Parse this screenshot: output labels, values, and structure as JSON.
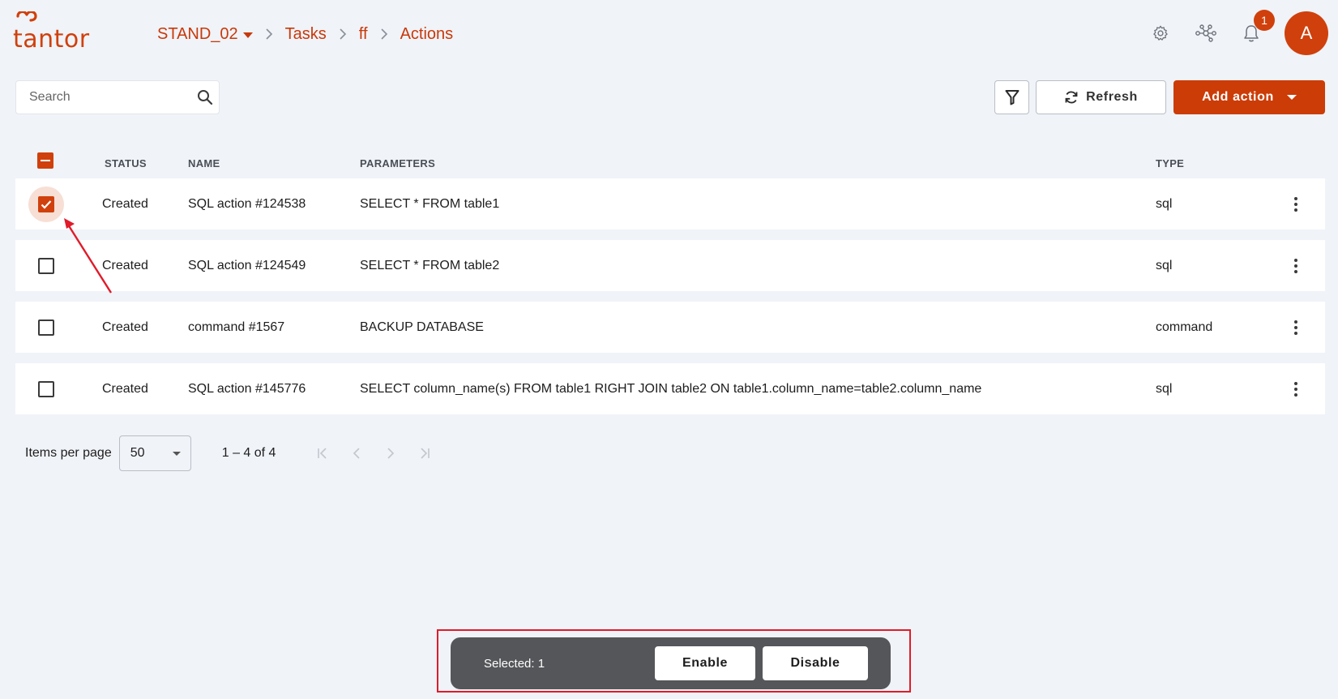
{
  "header": {
    "logo_text": "tantor",
    "breadcrumb": [
      {
        "label": "STAND_02",
        "has_dropdown": true
      },
      {
        "label": "Tasks"
      },
      {
        "label": "ff"
      },
      {
        "label": "Actions"
      }
    ],
    "notification_count": "1",
    "avatar_letter": "A",
    "icons": [
      "gear-icon",
      "network-icon",
      "bell-icon"
    ]
  },
  "toolbar": {
    "search_placeholder": "Search",
    "refresh_label": "Refresh",
    "add_action_label": "Add action"
  },
  "table": {
    "columns": [
      "STATUS",
      "NAME",
      "PARAMETERS",
      "TYPE"
    ],
    "rows": [
      {
        "checked": true,
        "status": "Created",
        "name": "SQL action #124538",
        "parameters": "SELECT * FROM table1",
        "type": "sql"
      },
      {
        "checked": false,
        "status": "Created",
        "name": "SQL action #124549",
        "parameters": "SELECT * FROM table2",
        "type": "sql"
      },
      {
        "checked": false,
        "status": "Created",
        "name": "command #1567",
        "parameters": "BACKUP DATABASE",
        "type": "command"
      },
      {
        "checked": false,
        "status": "Created",
        "name": "SQL action #145776",
        "parameters": "SELECT column_name(s) FROM table1 RIGHT JOIN table2 ON table1.column_name=table2.column_name",
        "type": "sql"
      }
    ]
  },
  "paginator": {
    "items_per_page_label": "Items per page",
    "page_size": "50",
    "range_label": "1 – 4 of 4"
  },
  "selection_bar": {
    "selected_label": "Selected: 1",
    "enable_label": "Enable",
    "disable_label": "Disable"
  },
  "colors": {
    "accent": "#cc3c07",
    "background": "#f0f3f8",
    "annotation": "#e01b2a"
  }
}
